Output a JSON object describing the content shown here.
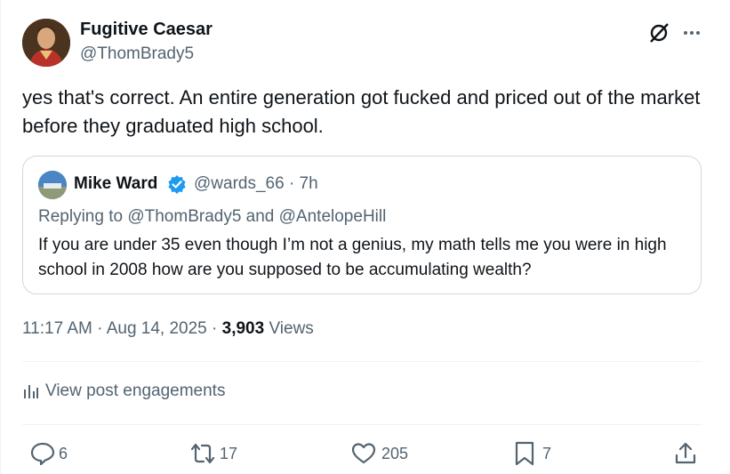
{
  "author": {
    "name": "Fugitive Caesar",
    "handle": "@ThomBrady5"
  },
  "tweet": {
    "text": "yes that's correct. An entire generation got fucked and priced out of the market before they graduated high school."
  },
  "quote": {
    "name": "Mike Ward",
    "handle_time": "@wards_66 · 7h",
    "reply_line": "Replying to @ThomBrady5 and @AntelopeHill",
    "text": "If you are under 35 even though I’m not a genius, my math tells me you were in high school in 2008 how are you supposed to be accumulating wealth?"
  },
  "meta": {
    "time_date": "11:17 AM · Aug 14, 2025 · ",
    "views_count": "3,903",
    "views_label": " Views"
  },
  "engagements_label": "View post engagements",
  "actions": {
    "reply_count": "6",
    "retweet_count": "17",
    "like_count": "205",
    "bookmark_count": "7"
  },
  "colors": {
    "text_primary": "#0f1419",
    "text_secondary": "#536471",
    "verified": "#1d9bf0",
    "border": "#cfd9de"
  },
  "icons": [
    "grok-icon",
    "more-icon",
    "verified-badge-icon",
    "analytics-icon",
    "reply-icon",
    "retweet-icon",
    "like-icon",
    "bookmark-icon",
    "share-icon"
  ]
}
